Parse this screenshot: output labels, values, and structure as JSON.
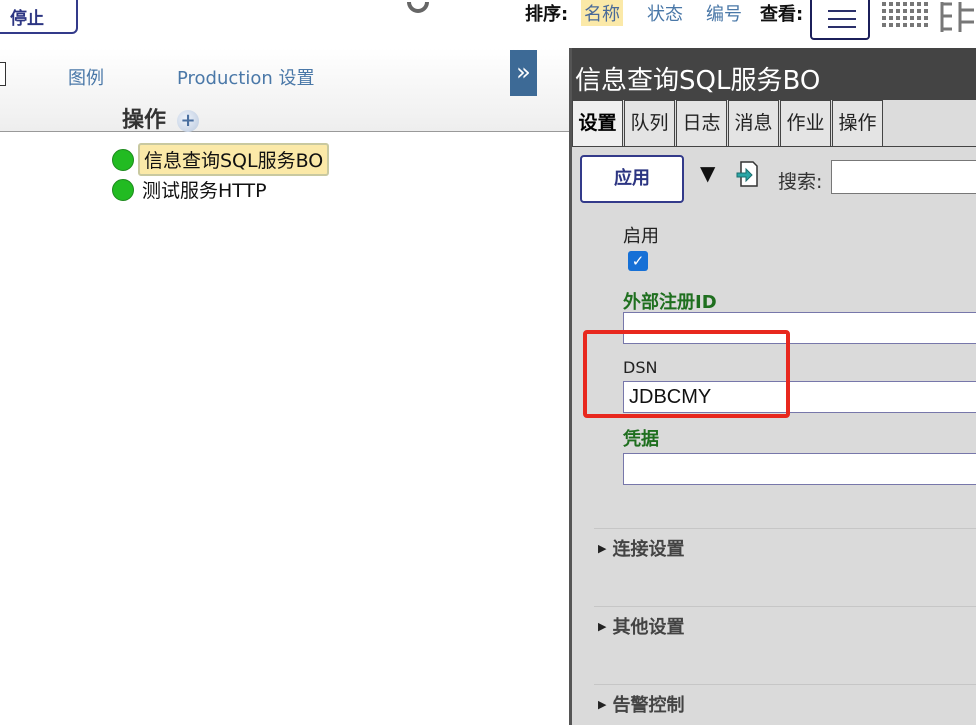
{
  "toolbar": {
    "stop_label": "停止",
    "sort_label": "排序:",
    "sort_options": [
      "名称",
      "状态",
      "编号"
    ],
    "sort_selected": "名称",
    "view_label": "查看:"
  },
  "left": {
    "tabs": [
      "图例",
      "Production 设置"
    ],
    "collapse_label": "»",
    "operations_heading": "操作",
    "services": [
      {
        "label": "信息查询SQL服务BO",
        "status_color": "#22bb22",
        "selected": true
      },
      {
        "label": "测试服务HTTP",
        "status_color": "#22bb22",
        "selected": false
      }
    ]
  },
  "detail": {
    "title": "信息查询SQL服务BO",
    "tabs": [
      "设置",
      "队列",
      "日志",
      "消息",
      "作业",
      "操作"
    ],
    "active_tab": "设置",
    "apply_label": "应用",
    "search_label": "搜索:",
    "search_value": "",
    "fields": {
      "enabled_label": "启用",
      "enabled_checked": true,
      "external_id_label": "外部注册ID",
      "external_id_value": "",
      "dsn_label": "DSN",
      "dsn_value": "JDBCMY",
      "credentials_label": "凭据",
      "credentials_value": ""
    },
    "sections": [
      "连接设置",
      "其他设置",
      "告警控制"
    ]
  },
  "colors": {
    "accent": "#333a8a",
    "link": "#4a78a8",
    "status_ok": "#22bb22",
    "field_label_green": "#1f6f1f",
    "highlight_red": "#e8281e"
  }
}
